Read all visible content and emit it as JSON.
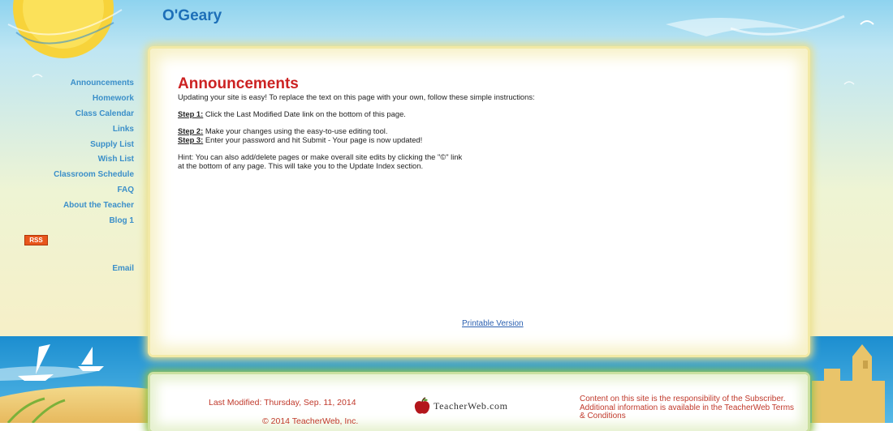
{
  "site": {
    "title": "O'Geary"
  },
  "nav": {
    "items": [
      "Announcements",
      "Homework",
      "Class Calendar",
      "Links",
      "Supply List",
      "Wish List",
      "Classroom Schedule",
      "FAQ",
      "About the Teacher",
      "Blog 1"
    ],
    "rss_label": "RSS",
    "email_label": "Email"
  },
  "main": {
    "heading": "Announcements",
    "intro": "Updating your site is easy! To replace the text on this page with your own, follow these simple instructions:",
    "step1_label": "Step 1:",
    "step1_text": "Click the Last Modified Date link on the bottom of this page.",
    "step2_label": "Step 2:",
    "step2_text": "Make your changes using the easy-to-use editing tool.",
    "step3_label": "Step 3:",
    "step3_text": "Enter your password and hit Submit - Your page is now updated!",
    "hint_line1": "Hint: You can also add/delete pages or make overall site edits by clicking the \"©\" link",
    "hint_line2": "at the bottom of any page. This will take you to the Update Index section.",
    "printable_label": "Printable Version"
  },
  "footer": {
    "last_modified": "Last Modified: Thursday, Sep. 11, 2014",
    "copyright": "© 2014 TeacherWeb, Inc.",
    "logo_text": "TeacherWeb.com",
    "notice": "Content on this site is the responsibility of the Subscriber. Additional information is available in the TeacherWeb Terms & Conditions"
  },
  "colors": {
    "accent_red": "#cc2222",
    "nav_blue": "#3b8fc9",
    "title_blue": "#1d6fb8",
    "sea_blue": "#1f8fd1"
  }
}
